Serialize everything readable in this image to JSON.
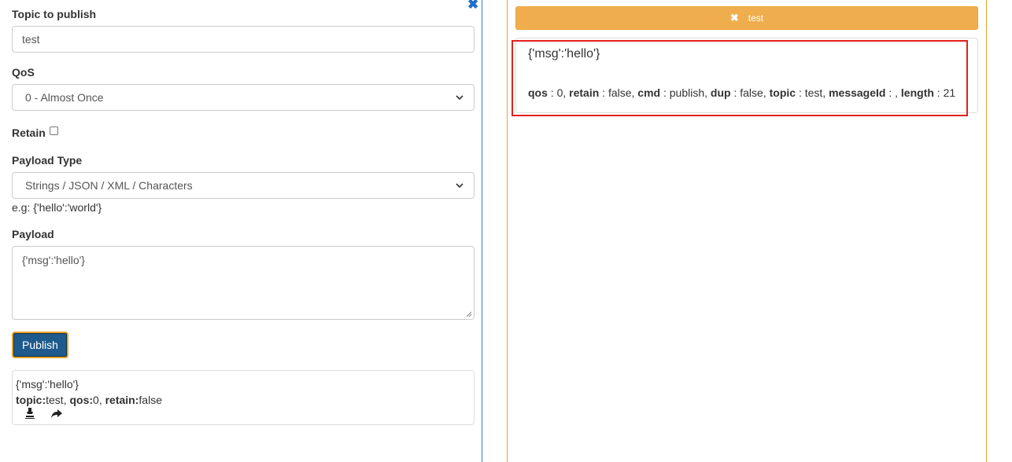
{
  "publish_form": {
    "topic_label": "Topic to publish",
    "topic_value": "test",
    "qos_label": "QoS",
    "qos_selected": "0 - Almost Once",
    "retain_label": "Retain",
    "retain_checked": false,
    "payload_type_label": "Payload Type",
    "payload_type_selected": "Strings / JSON / XML / Characters",
    "payload_type_hint": "e.g: {'hello':'world'}",
    "payload_label": "Payload",
    "payload_value": "{'msg':'hello'}",
    "publish_label": "Publish"
  },
  "sent_message": {
    "payload": "{'msg':'hello'}",
    "topic_label": "topic:",
    "topic_value": "test",
    "qos_label": "qos:",
    "qos_value": "0",
    "retain_label": "retain:",
    "retain_value": "false"
  },
  "subscription": {
    "topic": "test",
    "message": {
      "payload": "{'msg':'hello'}",
      "qos": "0",
      "retain": "false",
      "cmd": "publish",
      "dup": "false",
      "topic": "test",
      "messageId": "",
      "length": "21"
    }
  },
  "labels": {
    "qos": "qos",
    "retain": "retain",
    "cmd": "cmd",
    "dup": "dup",
    "topic": "topic",
    "messageId": "messageId",
    "length": "length"
  },
  "colors": {
    "primary": "#337ab7",
    "publish_button": "#1e5a8c",
    "warning": "#f0ad4e",
    "highlight": "#e3201b"
  },
  "icons": {
    "close": "close-icon",
    "unsubscribe": "times-icon",
    "copy": "stamp-icon",
    "resend": "share-arrow-icon"
  }
}
